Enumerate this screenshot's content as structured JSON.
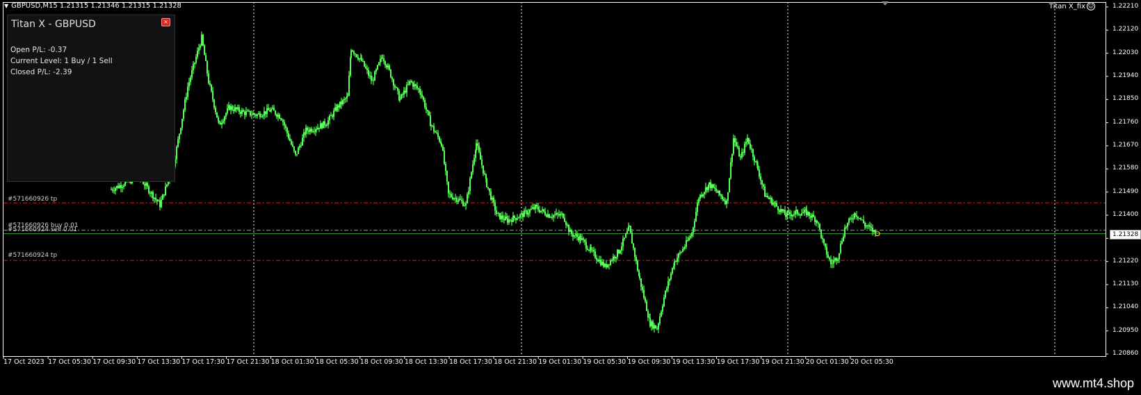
{
  "chart": {
    "header": "GBPUSD,M15  1.21315 1.21346 1.21315 1.21328",
    "ea_label": "Titan X_fix",
    "ea_face": "☺",
    "bg_color": "#000000",
    "candle_color": "#55ff55",
    "grid_color": "#ffffff",
    "tp_line_color": "#cc2222"
  },
  "panel": {
    "title": "Titan X - GBPUSD",
    "close_glyph": "×",
    "open_pl": "Open P/L: -0.37",
    "current_level": "Current Level: 1 Buy / 1 Sell",
    "closed_pl": "Closed P/L: -2.39"
  },
  "orders": {
    "tp_upper": "#571660926 tp",
    "buy": "#571660926 buy 0.01",
    "sell": "#571660924 sell 0.01",
    "tp_lower": "#571660924 tp"
  },
  "price_axis": {
    "ticks": [
      "1.22210",
      "1.22120",
      "1.22030",
      "1.21940",
      "1.21850",
      "1.21760",
      "1.21670",
      "1.21580",
      "1.21490",
      "1.21400",
      "1.21310",
      "1.21220",
      "1.21130",
      "1.21040",
      "1.20950",
      "1.20860"
    ],
    "current": "1.21328"
  },
  "time_axis": {
    "ticks": [
      "17 Oct 2023",
      "17 Oct 05:30",
      "17 Oct 09:30",
      "17 Oct 13:30",
      "17 Oct 17:30",
      "17 Oct 21:30",
      "18 Oct 01:30",
      "18 Oct 05:30",
      "18 Oct 09:30",
      "18 Oct 13:30",
      "18 Oct 17:30",
      "18 Oct 21:30",
      "19 Oct 01:30",
      "19 Oct 05:30",
      "19 Oct 09:30",
      "19 Oct 13:30",
      "19 Oct 17:30",
      "19 Oct 21:30",
      "20 Oct 01:30",
      "20 Oct 05:30"
    ]
  },
  "watermark": "www.mt4.shop"
}
